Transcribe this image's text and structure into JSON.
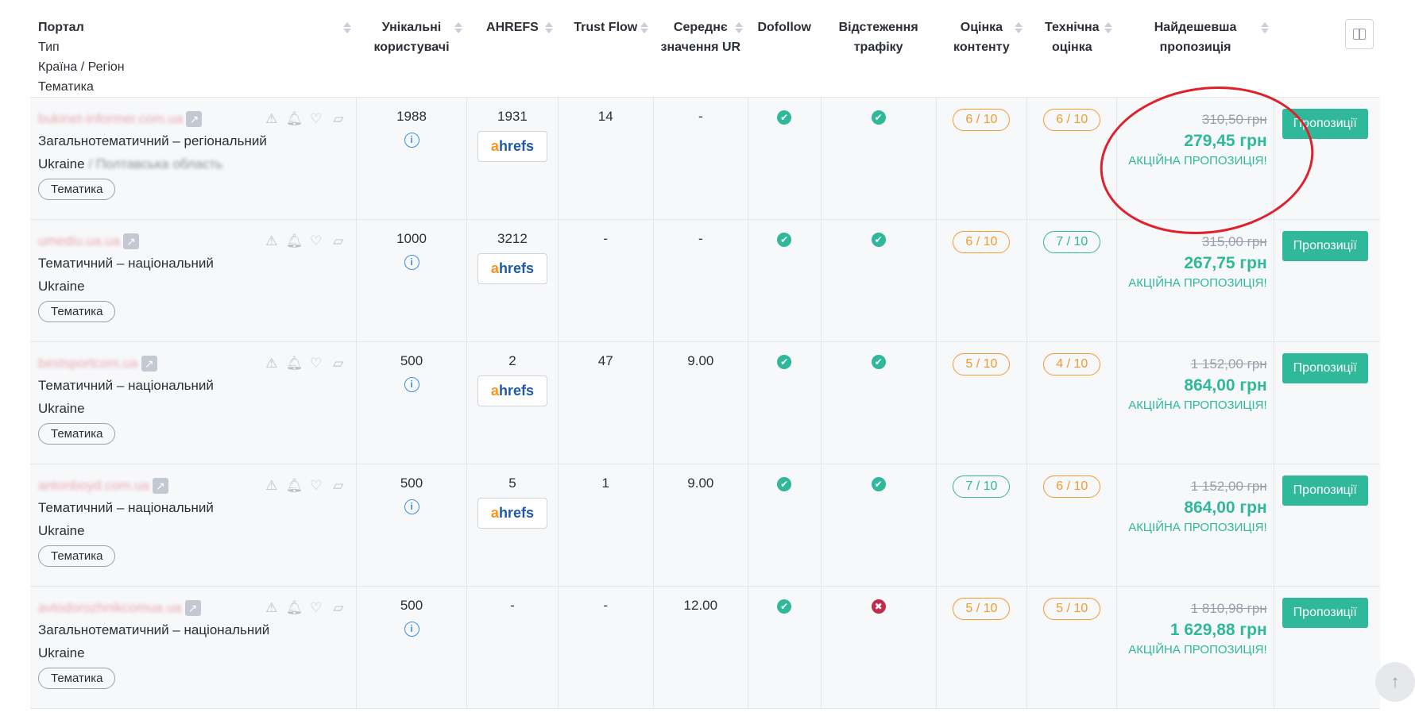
{
  "columns": {
    "portal": "Портал",
    "type": "Тип",
    "country": "Країна / Регіон",
    "topic": "Тематика",
    "users": "Унікальні користувачі",
    "ahrefs": "AHREFS",
    "trust": "Trust Flow",
    "ur": "Середнє значення UR",
    "dofollow": "Dofollow",
    "traffic": "Відстеження трафіку",
    "content": "Оцінка контенту",
    "tech": "Технічна оцінка",
    "price": "Найдешевша пропозиція"
  },
  "rows": [
    {
      "site": "bukinet-informer.com.ua",
      "type": "Загальнотематичний – регіональний",
      "country": "Ukraine",
      "region": "/ Полтавська область",
      "tag": "Тематика",
      "users": "1988",
      "ahrefs": "1931",
      "ahrefs_logo": true,
      "trust": "14",
      "ur": "-",
      "dofollow": "yes",
      "traffic": "yes",
      "content": "6 / 10",
      "content_color": "orange",
      "tech": "6 / 10",
      "tech_color": "orange",
      "old_price": "310,50 грн",
      "new_price": "279,45 грн",
      "promo": "АКЦІЙНА ПРОПОЗИЦІЯ!",
      "button": "Пропозиції"
    },
    {
      "site": "umediu.ua.ua",
      "type": "Тематичний – національний",
      "country": "Ukraine",
      "region": "",
      "tag": "Тематика",
      "users": "1000",
      "ahrefs": "3212",
      "ahrefs_logo": true,
      "trust": "-",
      "ur": "-",
      "dofollow": "yes",
      "traffic": "yes",
      "content": "6 / 10",
      "content_color": "orange",
      "tech": "7 / 10",
      "tech_color": "green",
      "old_price": "315,00 грн",
      "new_price": "267,75 грн",
      "promo": "АКЦІЙНА ПРОПОЗИЦІЯ!",
      "button": "Пропозиції"
    },
    {
      "site": "bestsportcom.ua",
      "type": "Тематичний – національний",
      "country": "Ukraine",
      "region": "",
      "tag": "Тематика",
      "users": "500",
      "ahrefs": "2",
      "ahrefs_logo": true,
      "trust": "47",
      "ur": "9.00",
      "dofollow": "yes",
      "traffic": "yes",
      "content": "5 / 10",
      "content_color": "orange",
      "tech": "4 / 10",
      "tech_color": "orange",
      "old_price": "1 152,00 грн",
      "new_price": "864,00 грн",
      "promo": "АКЦІЙНА ПРОПОЗИЦІЯ!",
      "button": "Пропозиції"
    },
    {
      "site": "antonboyd.com.ua",
      "type": "Тематичний – національний",
      "country": "Ukraine",
      "region": "",
      "tag": "Тематика",
      "users": "500",
      "ahrefs": "5",
      "ahrefs_logo": true,
      "trust": "1",
      "ur": "9.00",
      "dofollow": "yes",
      "traffic": "yes",
      "content": "7 / 10",
      "content_color": "green",
      "tech": "6 / 10",
      "tech_color": "orange",
      "old_price": "1 152,00 грн",
      "new_price": "864,00 грн",
      "promo": "АКЦІЙНА ПРОПОЗИЦІЯ!",
      "button": "Пропозиції"
    },
    {
      "site": "avtodorozhnikcomua.ua",
      "type": "Загальнотематичний – національний",
      "country": "Ukraine",
      "region": "",
      "tag": "Тематика",
      "users": "500",
      "ahrefs": "-",
      "ahrefs_logo": false,
      "trust": "-",
      "ur": "12.00",
      "dofollow": "yes",
      "traffic": "no",
      "content": "5 / 10",
      "content_color": "orange",
      "tech": "5 / 10",
      "tech_color": "orange",
      "old_price": "1 810,98 грн",
      "new_price": "1 629,88 грн",
      "promo": "АКЦІЙНА ПРОПОЗИЦІЯ!",
      "button": "Пропозиції"
    }
  ],
  "icons": {
    "external": "external-link-icon",
    "warning": "warning-icon",
    "bell": "bell-icon",
    "heart": "heart-icon",
    "note": "note-icon",
    "info": "info-icon"
  },
  "colors": {
    "accent": "#2fb89a",
    "orange": "#f39a2d",
    "danger": "#c22a4e",
    "annotation": "#e0202a"
  }
}
